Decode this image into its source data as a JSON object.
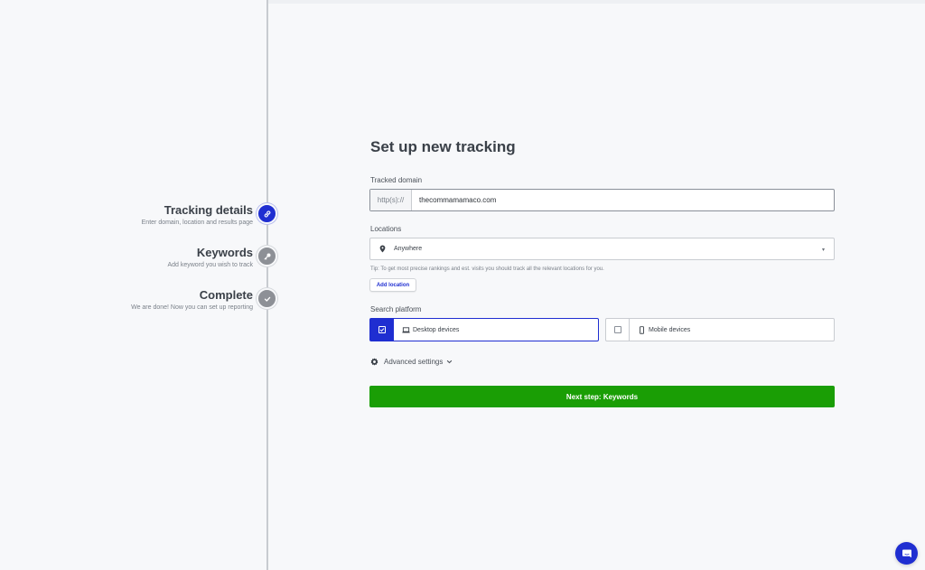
{
  "steps": [
    {
      "title": "Tracking details",
      "subtitle": "Enter domain, location and results page",
      "icon": "link-icon",
      "active": true
    },
    {
      "title": "Keywords",
      "subtitle": "Add keyword you wish to track",
      "icon": "key-icon",
      "active": false
    },
    {
      "title": "Complete",
      "subtitle": "We are done! Now you can set up reporting",
      "icon": "check-icon",
      "active": false
    }
  ],
  "form": {
    "title": "Set up new tracking",
    "domain": {
      "label": "Tracked domain",
      "prefix": "http(s)://",
      "value": "thecommamamaco.com"
    },
    "locations": {
      "label": "Locations",
      "selected": "Anywhere",
      "tip": "Tip: To get most precise rankings and est. visits you should track all the relevant locations for you.",
      "add_label": "Add location"
    },
    "platform": {
      "label": "Search platform",
      "options": [
        {
          "label": "Desktop devices",
          "checked": true,
          "icon": "laptop-icon"
        },
        {
          "label": "Mobile devices",
          "checked": false,
          "icon": "mobile-icon"
        }
      ]
    },
    "advanced_label": "Advanced settings",
    "next_label": "Next step: Keywords"
  },
  "colors": {
    "accent": "#1f2ed1",
    "success": "#1a9e05",
    "muted": "#8d9096"
  }
}
